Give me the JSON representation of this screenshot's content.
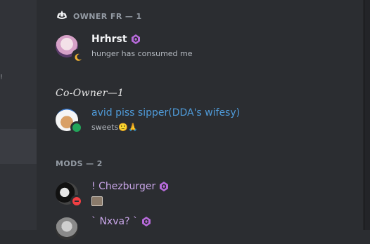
{
  "left_fragment": "!",
  "categories": {
    "owner": "OWNER FR — 1",
    "coowner": "Co-Owner—1",
    "mods": "MODS — 2"
  },
  "members": [
    {
      "name": "Hrhrst",
      "status": "hunger has consumed me",
      "name_color": "#f2f3f5",
      "status_dot": "idle"
    },
    {
      "name": "avid piss sipper(DDA's wifesy)",
      "status": "sweets🙂🙏",
      "name_color": "#4f9bd9",
      "status_dot": "online"
    },
    {
      "name": "! Chezburger",
      "status": "",
      "name_color": "#c9a6e8",
      "status_dot": "dnd"
    },
    {
      "name": "` Nxva? `",
      "status": "",
      "name_color": "#c9a6e8",
      "status_dot": "none"
    }
  ],
  "colors": {
    "boost": "#b86bdb",
    "online": "#23a55a",
    "idle": "#f0b232",
    "dnd": "#f23f43"
  }
}
